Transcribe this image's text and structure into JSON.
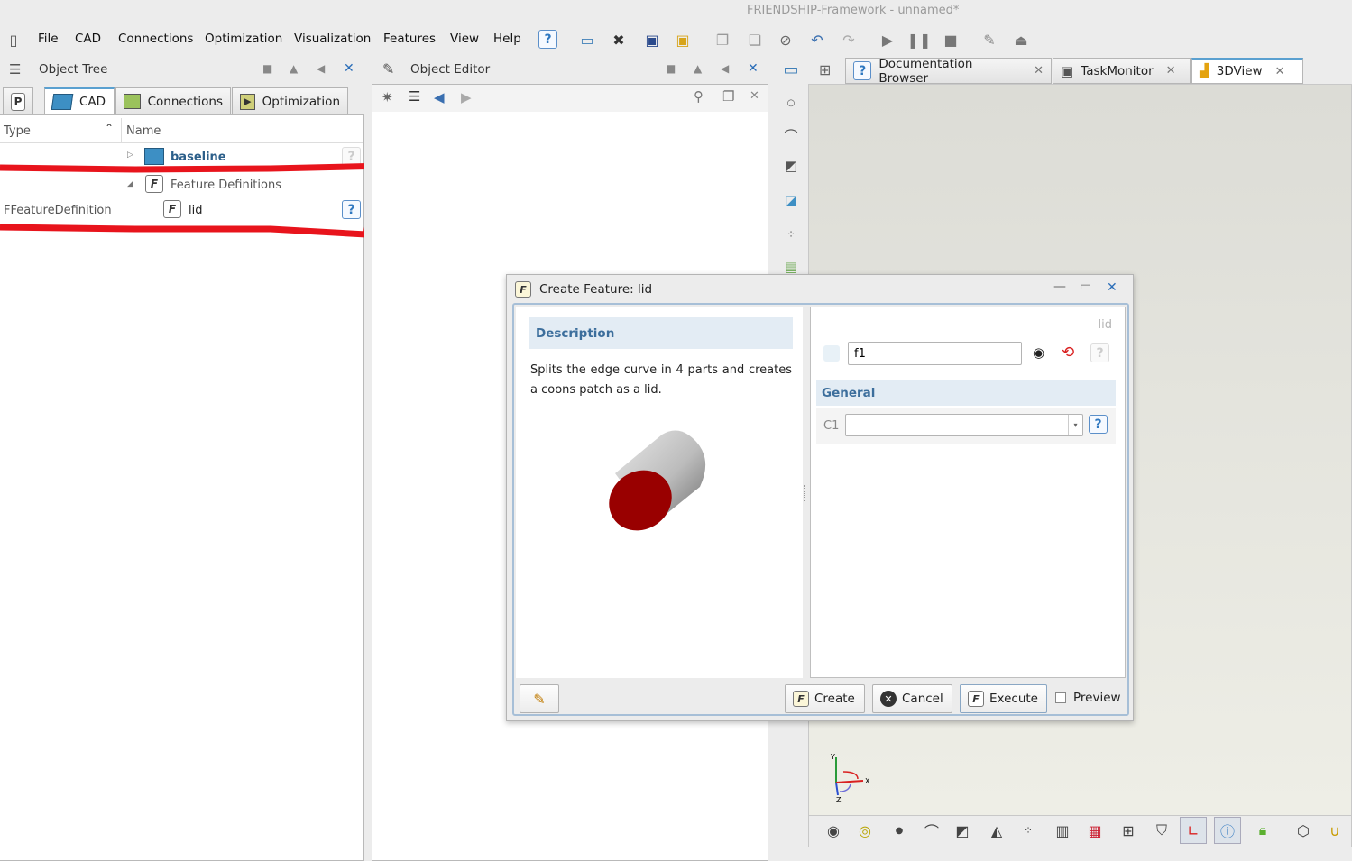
{
  "window": {
    "title": "FRIENDSHIP-Framework - unnamed*"
  },
  "menu": {
    "items": [
      "File",
      "CAD",
      "Connections",
      "Optimization",
      "Visualization",
      "Features",
      "View",
      "Help"
    ]
  },
  "object_tree": {
    "title": "Object Tree",
    "tabs": [
      "P",
      "CAD",
      "Connections",
      "Optimization"
    ],
    "columns": {
      "type": "Type",
      "name": "Name"
    },
    "rows": [
      {
        "type": "",
        "name": "baseline"
      },
      {
        "type": "",
        "name": "Feature Definitions"
      },
      {
        "type": "FFeatureDefinition",
        "name": "lid"
      }
    ]
  },
  "object_editor": {
    "title": "Object Editor"
  },
  "right_tabs": [
    "Documentation Browser",
    "TaskMonitor",
    "3DView"
  ],
  "dialog": {
    "title": "Create Feature: lid",
    "description_header": "Description",
    "description_text": "Splits the edge curve in 4 parts and creates a coons patch as a lid.",
    "type_label": "lid",
    "name_value": "f1",
    "general_header": "General",
    "c1_label": "C1",
    "c1_value": "",
    "buttons": {
      "create": "Create",
      "cancel": "Cancel",
      "execute": "Execute",
      "preview": "Preview"
    }
  },
  "axis": {
    "y": "Y",
    "x": "X",
    "z": "Z"
  },
  "colors": {
    "accent": "#5aa0d0",
    "highlight_red": "#e8141c",
    "lid_red": "#8b0000"
  }
}
